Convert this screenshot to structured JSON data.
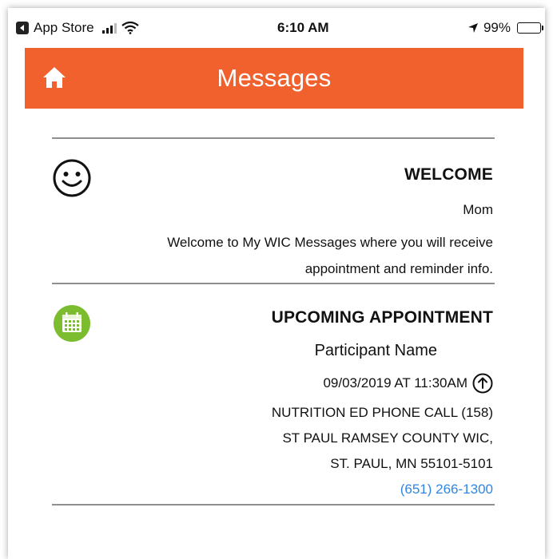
{
  "status_bar": {
    "back_app": "App Store",
    "time": "6:10 AM",
    "battery": "99%",
    "icons": [
      "back-app-icon",
      "signal-icon",
      "wifi-icon",
      "location-icon",
      "battery-icon"
    ]
  },
  "header": {
    "title": "Messages",
    "home_icon": "home-icon",
    "background_color": "#f1612d"
  },
  "messages": {
    "welcome": {
      "icon": "smiley-icon",
      "title": "WELCOME",
      "sender": "Mom",
      "body": "Welcome to My WIC Messages where you will receive appointment and reminder info."
    },
    "appointment": {
      "icon": "calendar-icon",
      "icon_color": "#7cbd2f",
      "title": "UPCOMING APPOINTMENT",
      "participant": "Participant Name",
      "datetime": "09/03/2019 AT 11:30AM",
      "datetime_icon": "up-arrow-icon",
      "type": "NUTRITION ED PHONE CALL (158)",
      "clinic": "ST PAUL RAMSEY COUNTY WIC,",
      "city": "ST. PAUL, MN 55101-5101",
      "phone": "(651) 266-1300",
      "phone_color": "#2f86e6"
    }
  }
}
